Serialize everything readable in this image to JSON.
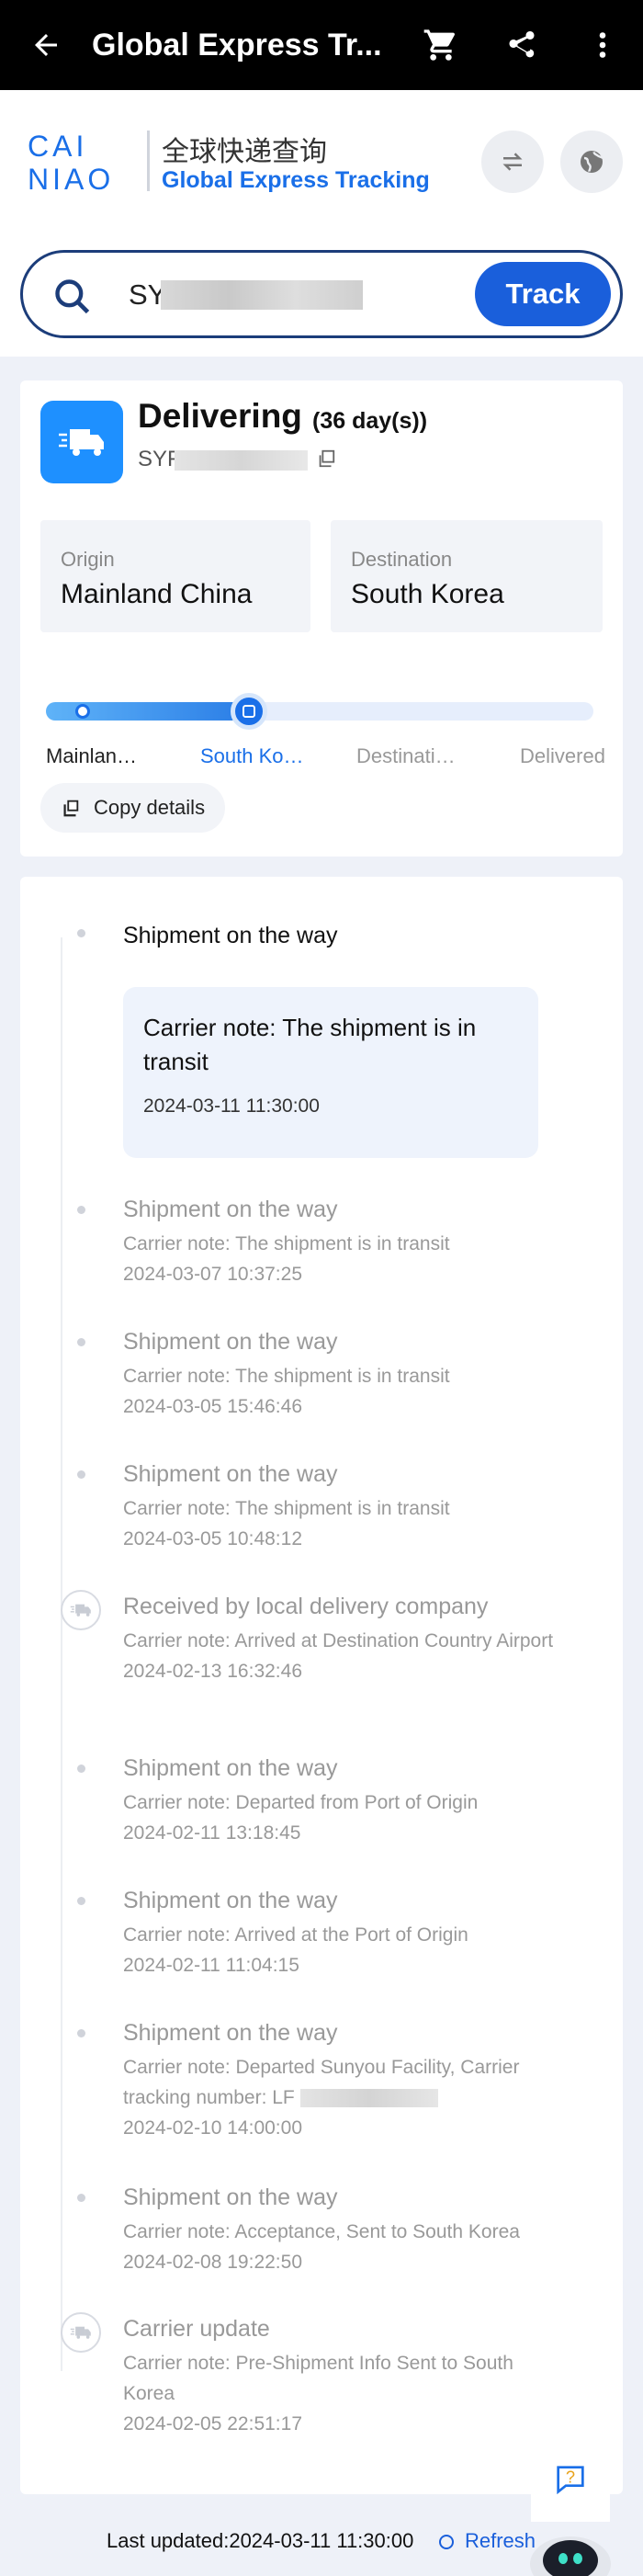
{
  "appbar": {
    "title": "Global Express Tr...",
    "icons": [
      "back-arrow-icon",
      "cart-icon",
      "share-icon",
      "more-vert-icon"
    ]
  },
  "brand": {
    "logo_text": "CAINIAO",
    "cn_title": "全球快递查询",
    "en_title": "Global Express Tracking"
  },
  "search": {
    "value": "SYF",
    "button_label": "Track"
  },
  "status": {
    "title": "Delivering",
    "days": "(36 day(s))",
    "tracking_prefix": "SYF",
    "origin_label": "Origin",
    "origin_value": "Mainland China",
    "destination_label": "Destination",
    "destination_value": "South Korea",
    "progress_fraction": 0.37,
    "stages": [
      {
        "label": "Mainlan…",
        "state": "done"
      },
      {
        "label": "South Ko…",
        "state": "current"
      },
      {
        "label": "Destinati…",
        "state": "pending"
      },
      {
        "label": "Delivered",
        "state": "pending"
      }
    ],
    "copy_label": "Copy details"
  },
  "timeline": {
    "first": {
      "title": "Shipment on the way",
      "note": "Carrier note: The shipment is in transit",
      "time": "2024-03-11 11:30:00"
    },
    "events": [
      {
        "title": "Shipment on the way",
        "note": "Carrier note: The shipment is in transit",
        "time": "2024-03-07 10:37:25",
        "icon": "dot"
      },
      {
        "title": "Shipment on the way",
        "note": "Carrier note: The shipment is in transit",
        "time": "2024-03-05 15:46:46",
        "icon": "dot"
      },
      {
        "title": "Shipment on the way",
        "note": "Carrier note: The shipment is in transit",
        "time": "2024-03-05 10:48:12",
        "icon": "dot"
      },
      {
        "title": "Received by local delivery company",
        "note": "Carrier note: Arrived at Destination Country Airport",
        "time": "2024-02-13 16:32:46",
        "icon": "truck"
      },
      {
        "title": "Shipment on the way",
        "note": "Carrier note: Departed from Port of Origin",
        "time": "2024-02-11 13:18:45",
        "icon": "dot"
      },
      {
        "title": "Shipment on the way",
        "note": "Carrier note: Arrived at the Port of Origin",
        "time": "2024-02-11 11:04:15",
        "icon": "dot"
      },
      {
        "title": "Shipment on the way",
        "note": "Carrier note: Departed Sunyou Facility, Carrier tracking number: LF",
        "time": "2024-02-10 14:00:00",
        "icon": "dot"
      },
      {
        "title": "Shipment on the way",
        "note": "Carrier note: Acceptance, Sent to South Korea",
        "time": "2024-02-08 19:22:50",
        "icon": "dot"
      },
      {
        "title": "Carrier update",
        "note": "Carrier note: Pre-Shipment Info Sent to South Korea",
        "time": "2024-02-05 22:51:17",
        "icon": "truck"
      }
    ]
  },
  "footer": {
    "last_updated": "Last updated:2024-03-11 11:30:00",
    "refresh_label": "Refresh"
  },
  "colors": {
    "accent": "#1a5fdb",
    "brand_blue": "#1a6fe8",
    "background": "#eef1f8"
  }
}
